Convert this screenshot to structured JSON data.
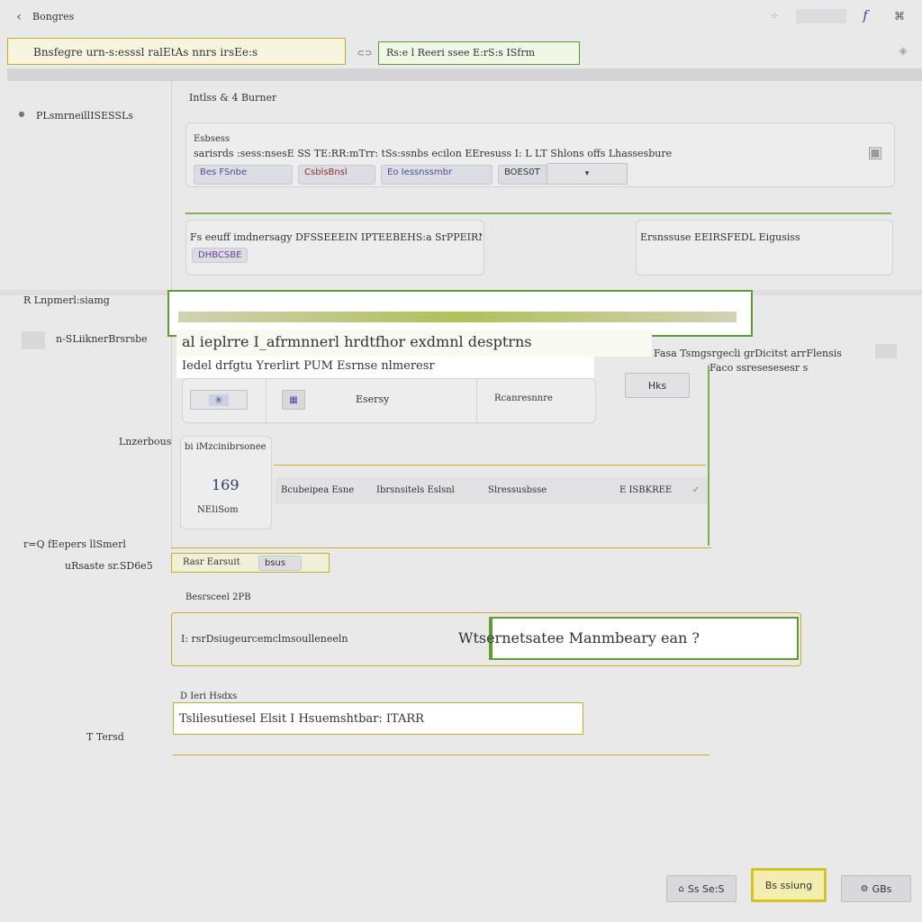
{
  "topbar": {
    "back_label": "Bongres",
    "right_icon_1": "f",
    "right_icon_2": "⌘"
  },
  "search_row": {
    "field_left_text": "Bnsfegre   urn-s:esssl   ralEtAs   nnrs  irsEe:s",
    "field_right_text": "Rs:e   l   Reeri ssee E:rS:s ISfrm"
  },
  "section_header": "Intlss  &  4  Burner",
  "left_labels": {
    "l1": "PLsmrneillISESSLs",
    "l2": "R  Lnpmerl:siamg",
    "l3": "n-SLiiknerBrsrsbe",
    "l4": "Lnzerbous",
    "l5": "r=Q  fEepers  llSmerl",
    "l6": "uRsaste  sr.SD6e5",
    "l7": "T  Tersd"
  },
  "card1": {
    "label_top": "Esbsess",
    "label_row": "sarisrds   :sess:nsesE   SS  TE:RR:mTrr:   tSs:ssnbs   ecilon  EEresuss  I: L LT  Shlons offs  Lhassesbure",
    "chips": [
      "Bes  FSnbe",
      "CsblsBnsl",
      "Eo  Iessnssmbr",
      "BOES0T"
    ]
  },
  "card2": {
    "text_left": "Fs  eeuff  imdnersagy  DFSSEEEIN  IPTEEBEHS:a SrPPEIRMNl",
    "text_right": "Ersnssuse   EEIRSFEDL  Eigusiss",
    "chip": "DHBCSBE"
  },
  "highlight1": {
    "line1": "al  ieplrre  I_afrmnnerl  hrdtfhor  exdmnl  desptrns",
    "line2": "Iedel   drfgtu   Yrerlirt   PUM  Esrnse  nlmeresr",
    "right_text_a": "Fasa  Tsmgsrgecli  grDicitst  arrFlensis",
    "right_text_b": "Faco  ssresesesesr  s"
  },
  "card3": {
    "items": [
      "✳",
      "Esersy",
      "Rcanresnnre",
      "Hks"
    ]
  },
  "card4": {
    "title": "bi  iMzcinibrsonee",
    "value": "169",
    "caption": "NEIiSom"
  },
  "chips_row": {
    "items": [
      "Bcubeipea  Esne",
      "Ibrsnsitels  Eslsnl",
      "Slressusbsse",
      "E  ISBKREE"
    ]
  },
  "tag_row": {
    "label": "Rasr  Earsuit",
    "chip": "bsus"
  },
  "section2_header": "Besrsceel  2PB",
  "bottom_box": {
    "left_text": "I:  rsrDsiugeurcemclmsoulleneeln",
    "right_text": "Wtsernetsatee  Manmbeary  ean  ?"
  },
  "bottom_section": {
    "header": "D  Ieri  Hsdxs",
    "highlight_text": "Tslilesutiesel  Elsit  I  Hsuemshtbar:  ITARR"
  },
  "footer": {
    "btn1": "Ss  Se:S",
    "btn2": "Bs  ssiung",
    "btn3": "GBs"
  },
  "colors": {
    "accent_green": "#5f9d34",
    "accent_yellow": "#c6ad2c",
    "background": "#e9e9ea",
    "chip_blue": "#4a4e9a"
  }
}
